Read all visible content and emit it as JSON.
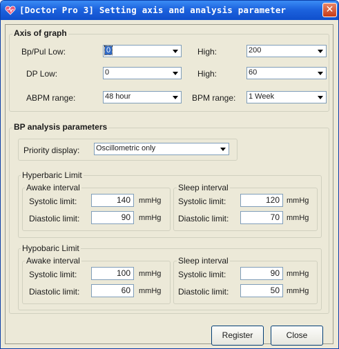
{
  "window": {
    "title": "[Doctor Pro 3] Setting axis and analysis parameter",
    "app_icon": "heart-icon",
    "close_icon": "close-icon",
    "title_bar_color": "#1d63de",
    "close_button_color": "#c73a15"
  },
  "axis_group": {
    "title": "Axis of graph",
    "bp_pul_low": {
      "label": "Bp/Pul  Low:",
      "value": "0"
    },
    "bp_pul_high": {
      "label": "High:",
      "value": "200"
    },
    "dp_low": {
      "label": "DP Low:",
      "value": "0"
    },
    "dp_high": {
      "label": "High:",
      "value": "60"
    },
    "abpm_range": {
      "label": "ABPM range:",
      "value": "48 hour"
    },
    "bpm_range": {
      "label": "BPM range:",
      "value": "1 Week"
    }
  },
  "analysis_group": {
    "title": "BP analysis parameters",
    "priority": {
      "label": "Priority display:",
      "value": "Oscillometric only"
    },
    "hyper": {
      "title": "Hyperbaric Limit",
      "awake": {
        "title": "Awake interval",
        "systolic_label": "Systolic limit:",
        "systolic": "140",
        "diastolic_label": "Diastolic limit:",
        "diastolic": "90",
        "unit": "mmHg"
      },
      "sleep": {
        "title": "Sleep interval",
        "systolic_label": "Systolic limit:",
        "systolic": "120",
        "diastolic_label": "Diastolic limit:",
        "diastolic": "70",
        "unit": "mmHg"
      }
    },
    "hypo": {
      "title": "Hypobaric Limit",
      "awake": {
        "title": "Awake interval",
        "systolic_label": "Systolic limit:",
        "systolic": "100",
        "diastolic_label": "Diastolic limit:",
        "diastolic": "60",
        "unit": "mmHg"
      },
      "sleep": {
        "title": "Sleep interval",
        "systolic_label": "Systolic limit:",
        "systolic": "90",
        "diastolic_label": "Diastolic limit:",
        "diastolic": "50",
        "unit": "mmHg"
      }
    }
  },
  "buttons": {
    "register": "Register",
    "close": "Close"
  }
}
